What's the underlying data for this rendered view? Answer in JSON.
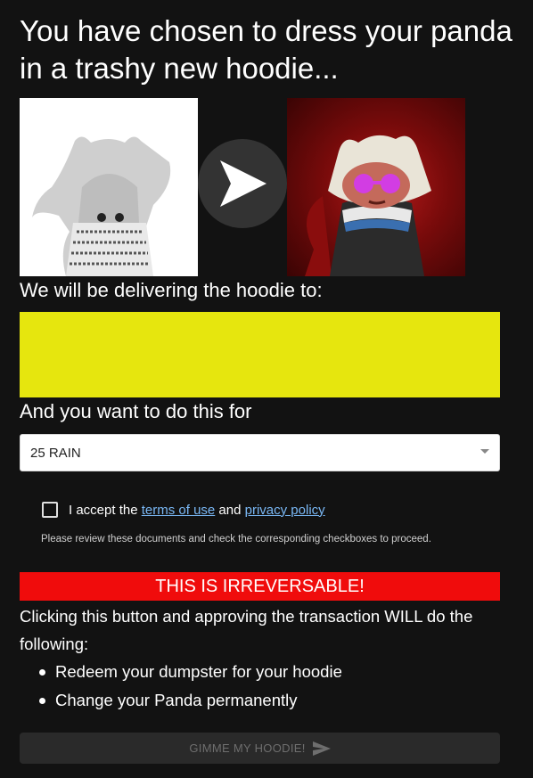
{
  "title": "You have chosen to dress your panda in a trashy new hoodie...",
  "delivery_label": "We will be delivering the hoodie to:",
  "price_label": "And you want to do this for",
  "price_select": {
    "value": "25 RAIN"
  },
  "terms": {
    "prefix": "I accept the ",
    "terms_link": "terms of use",
    "and": " and ",
    "privacy_link": "privacy policy",
    "note": "Please review these documents and check the corresponding checkboxes to proceed."
  },
  "warning": "THIS IS IRREVERSABLE!",
  "description": "Clicking this button and approving the transaction WILL do the following:",
  "effects": [
    "Redeem your dumpster for your hoodie",
    "Change your Panda permanently"
  ],
  "submit_label": "GIMME MY HOODIE!",
  "colors": {
    "address_highlight": "#e6e60e",
    "warning_bg": "#f00c0c",
    "link": "#7ab8f5"
  },
  "icons": {
    "arrow": "arrow-right-icon",
    "send": "send-icon",
    "caret": "chevron-down-icon"
  }
}
